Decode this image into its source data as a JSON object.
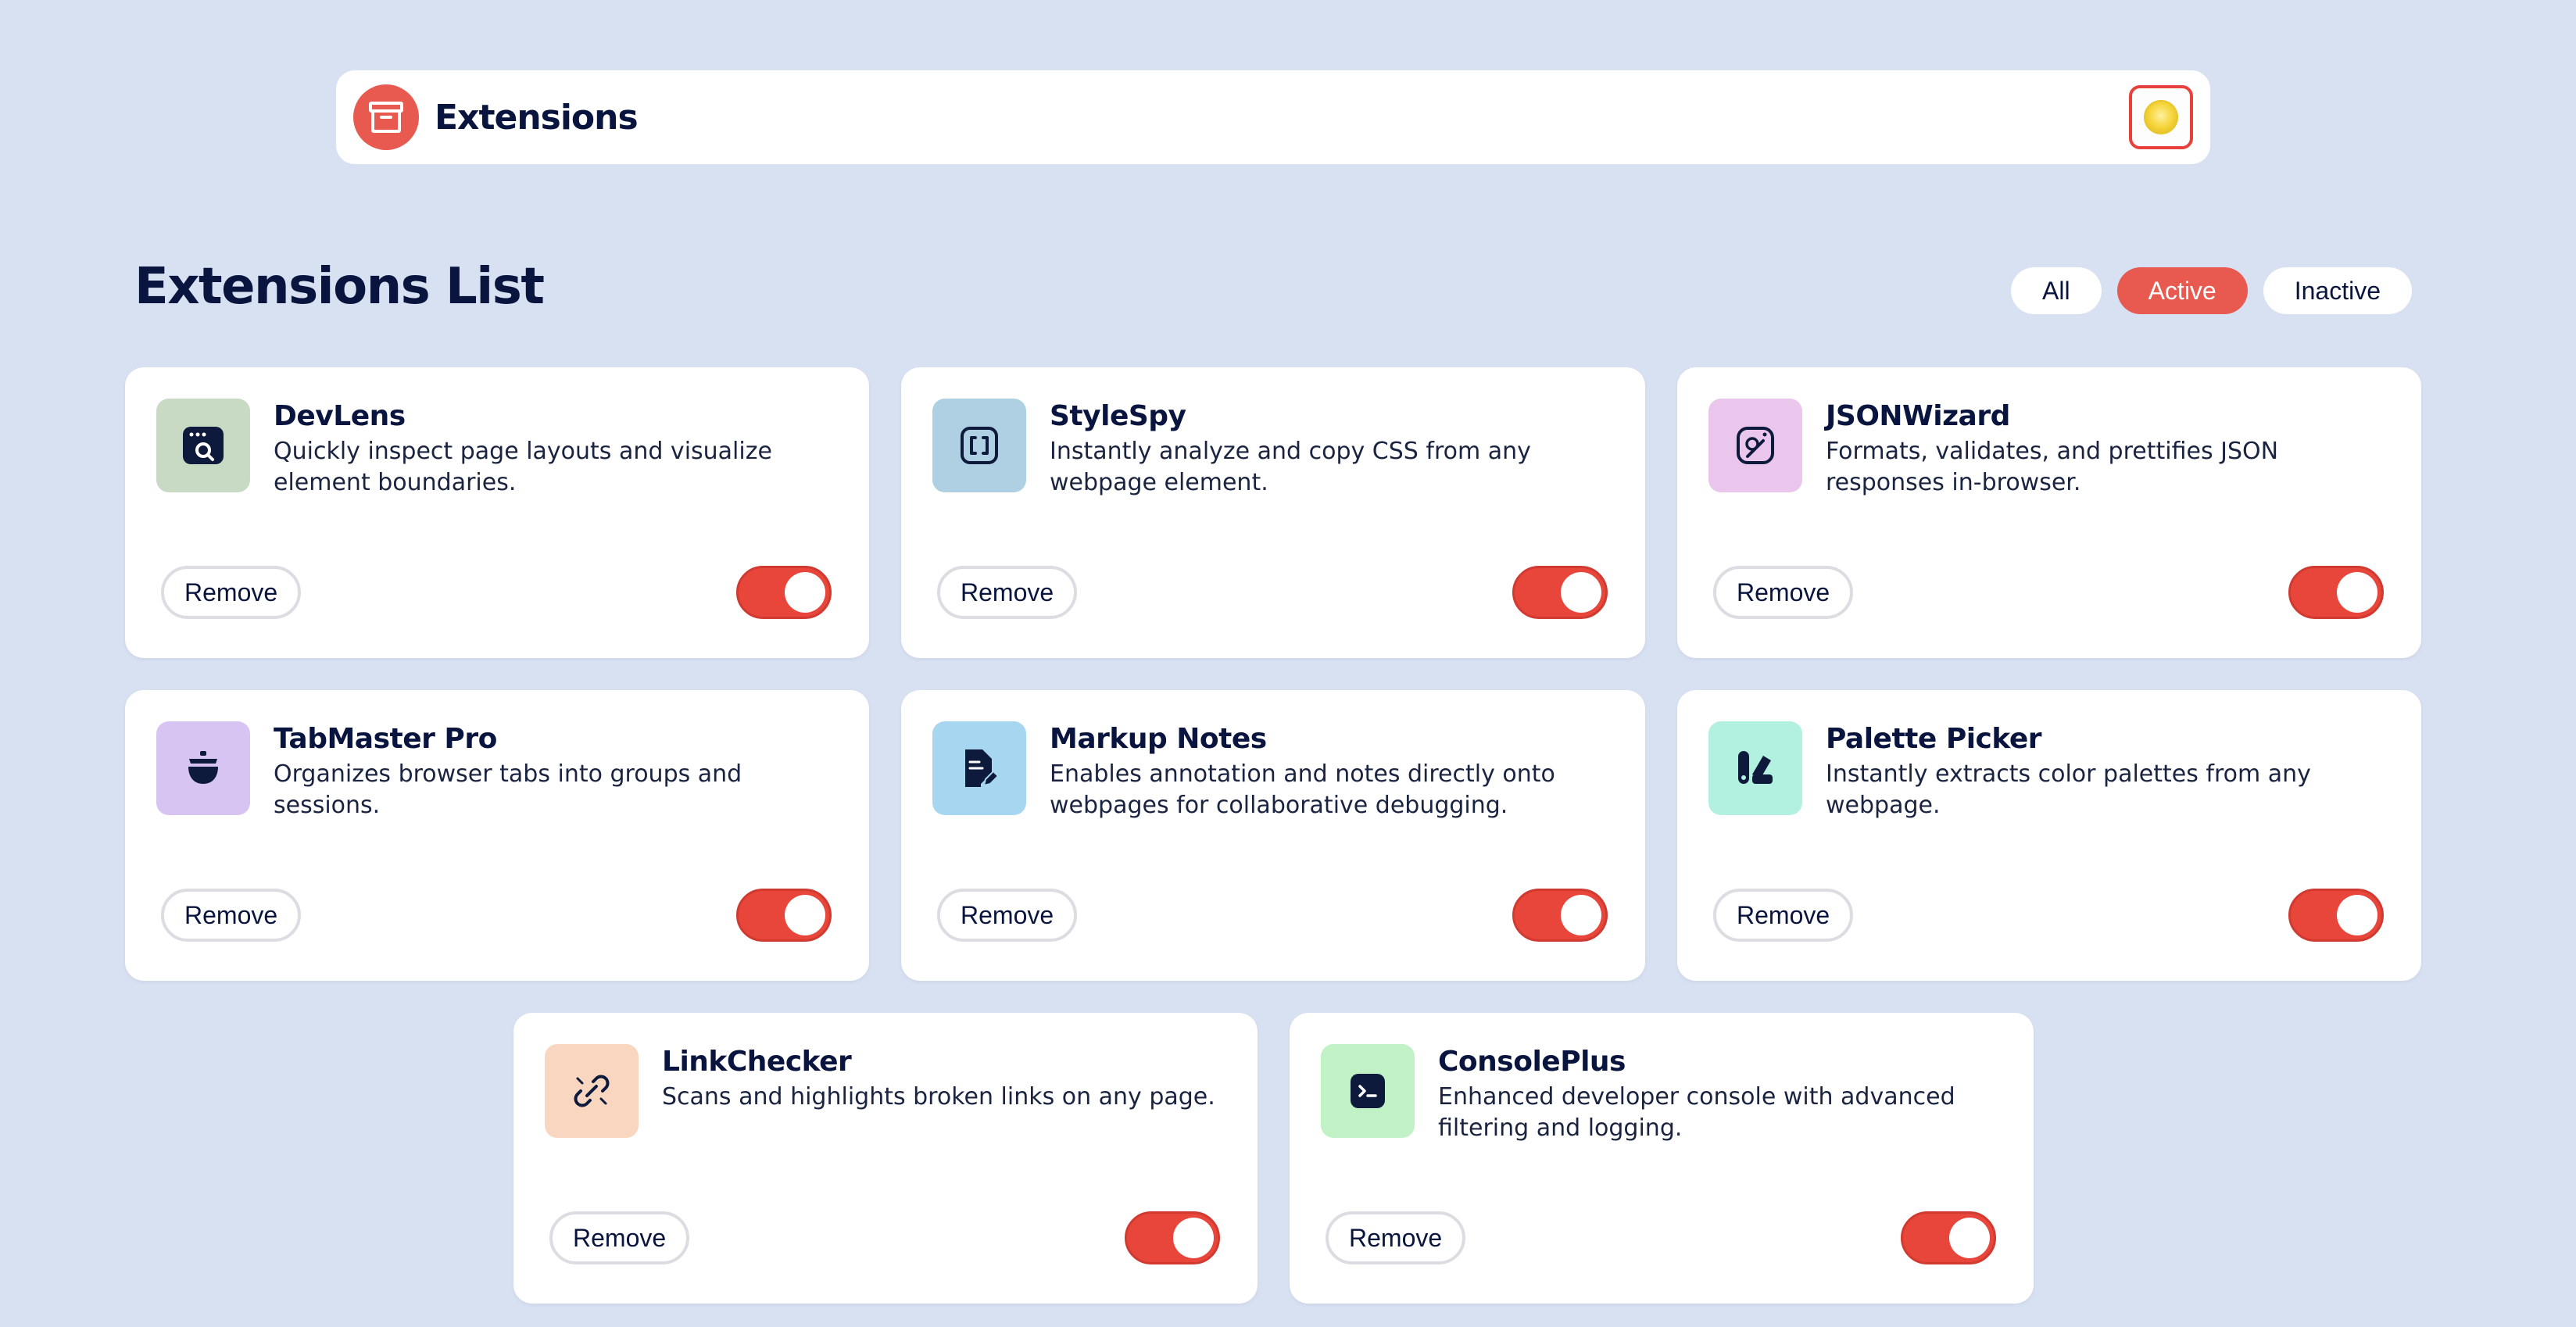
{
  "header": {
    "title": "Extensions",
    "logo_icon": "archive-box-icon",
    "theme_icon": "sun-icon",
    "accent_color": "#e85a4f"
  },
  "main": {
    "title": "Extensions List",
    "filters": [
      {
        "label": "All",
        "active": false
      },
      {
        "label": "Active",
        "active": true
      },
      {
        "label": "Inactive",
        "active": false
      }
    ]
  },
  "extensions": [
    {
      "name": "DevLens",
      "description": "Quickly inspect page layouts and visualize element boundaries.",
      "icon": "browser-search-icon",
      "icon_bg": "#c8d9c4",
      "remove_label": "Remove",
      "enabled": true
    },
    {
      "name": "StyleSpy",
      "description": "Instantly analyze and copy CSS from any webpage element.",
      "icon": "brackets-icon",
      "icon_bg": "#aed0e2",
      "remove_label": "Remove",
      "enabled": true
    },
    {
      "name": "JSONWizard",
      "description": "Formats, validates, and prettifies JSON responses in-browser.",
      "icon": "magic-wand-icon",
      "icon_bg": "#ebc6ec",
      "remove_label": "Remove",
      "enabled": true
    },
    {
      "name": "TabMaster Pro",
      "description": "Organizes browser tabs into groups and sessions.",
      "icon": "pot-icon",
      "icon_bg": "#d7c4f2",
      "remove_label": "Remove",
      "enabled": true
    },
    {
      "name": "Markup Notes",
      "description": "Enables annotation and notes directly onto webpages for collaborative debugging.",
      "icon": "note-pen-icon",
      "icon_bg": "#a6d6f0",
      "remove_label": "Remove",
      "enabled": true
    },
    {
      "name": "Palette Picker",
      "description": "Instantly extracts color palettes from any webpage.",
      "icon": "palette-icon",
      "icon_bg": "#b2f0e0",
      "remove_label": "Remove",
      "enabled": true
    },
    {
      "name": "LinkChecker",
      "description": "Scans and highlights broken links on any page.",
      "icon": "broken-link-icon",
      "icon_bg": "#f8d6c0",
      "remove_label": "Remove",
      "enabled": true
    },
    {
      "name": "ConsolePlus",
      "description": "Enhanced developer console with advanced filtering and logging.",
      "icon": "terminal-icon",
      "icon_bg": "#c0f2c6",
      "remove_label": "Remove",
      "enabled": true
    }
  ]
}
